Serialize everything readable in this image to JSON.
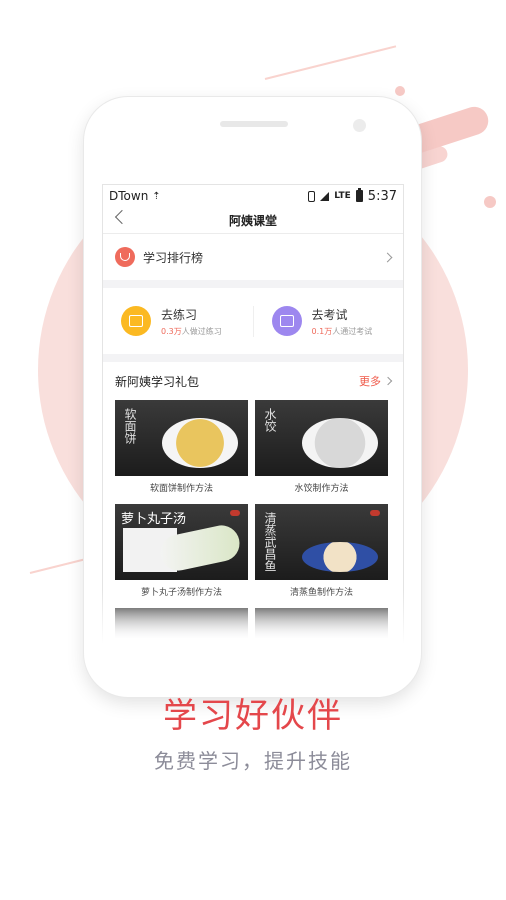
{
  "status_bar": {
    "carrier": "DTown",
    "network": "LTE",
    "time": "5:37"
  },
  "nav": {
    "title": "阿姨课堂"
  },
  "ranking": {
    "label": "学习排行榜"
  },
  "actions": [
    {
      "title": "去练习",
      "count": "0.3万",
      "suffix": "人做过练习",
      "color": "#fbb922"
    },
    {
      "title": "去考试",
      "count": "0.1万",
      "suffix": "人通过考试",
      "color": "#9d87ef"
    }
  ],
  "package": {
    "title": "新阿姨学习礼包",
    "more": "更多",
    "items": [
      {
        "label": "软面饼制作方法",
        "thumb_text": "软面饼"
      },
      {
        "label": "水饺制作方法",
        "thumb_text": "水饺"
      },
      {
        "label": "萝卜丸子汤制作方法",
        "thumb_text": "萝卜丸子汤"
      },
      {
        "label": "清蒸鱼制作方法",
        "thumb_text": "清蒸武昌鱼"
      }
    ]
  },
  "slogan": {
    "title": "学习好伙伴",
    "subtitle": "免费学习，提升技能"
  },
  "colors": {
    "accent": "#e4474b",
    "background_circle": "#f9dfdc"
  }
}
